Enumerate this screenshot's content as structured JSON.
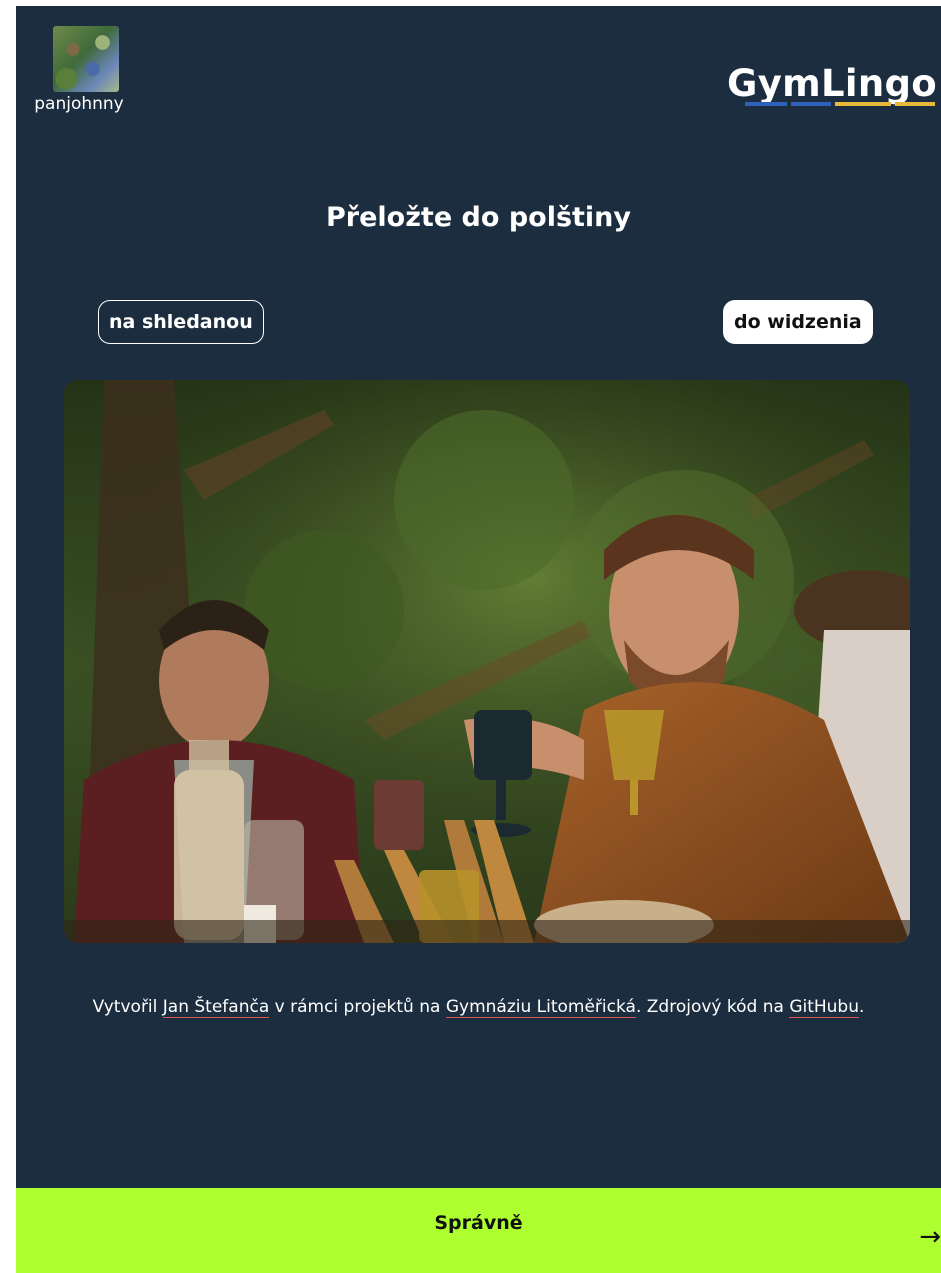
{
  "user": {
    "name": "panjohnny"
  },
  "brand": {
    "logo": "GymLingo"
  },
  "exercise": {
    "instruction": "Přeložte do polštiny",
    "source_word": "na shledanou",
    "answer_word": "do widzenia",
    "photo_icon": "photo-outdoor-dinner"
  },
  "credits": {
    "text_1": "Vytvořil ",
    "author": "Jan Štefanča",
    "text_2": " v rámci projektů na ",
    "school": "Gymnáziu Litoměřická",
    "text_3": ". Zdrojový kód na ",
    "repo": "GitHubu",
    "text_4": "."
  },
  "result": {
    "status": "Správně",
    "next_icon": "arrow-right-icon",
    "next_glyph": "→"
  },
  "colors": {
    "background": "#1c2d40",
    "success": "#adff2f",
    "link_underline": "#d3574a",
    "logo_blue": "#2f61b8",
    "logo_yellow": "#e6b93a"
  }
}
